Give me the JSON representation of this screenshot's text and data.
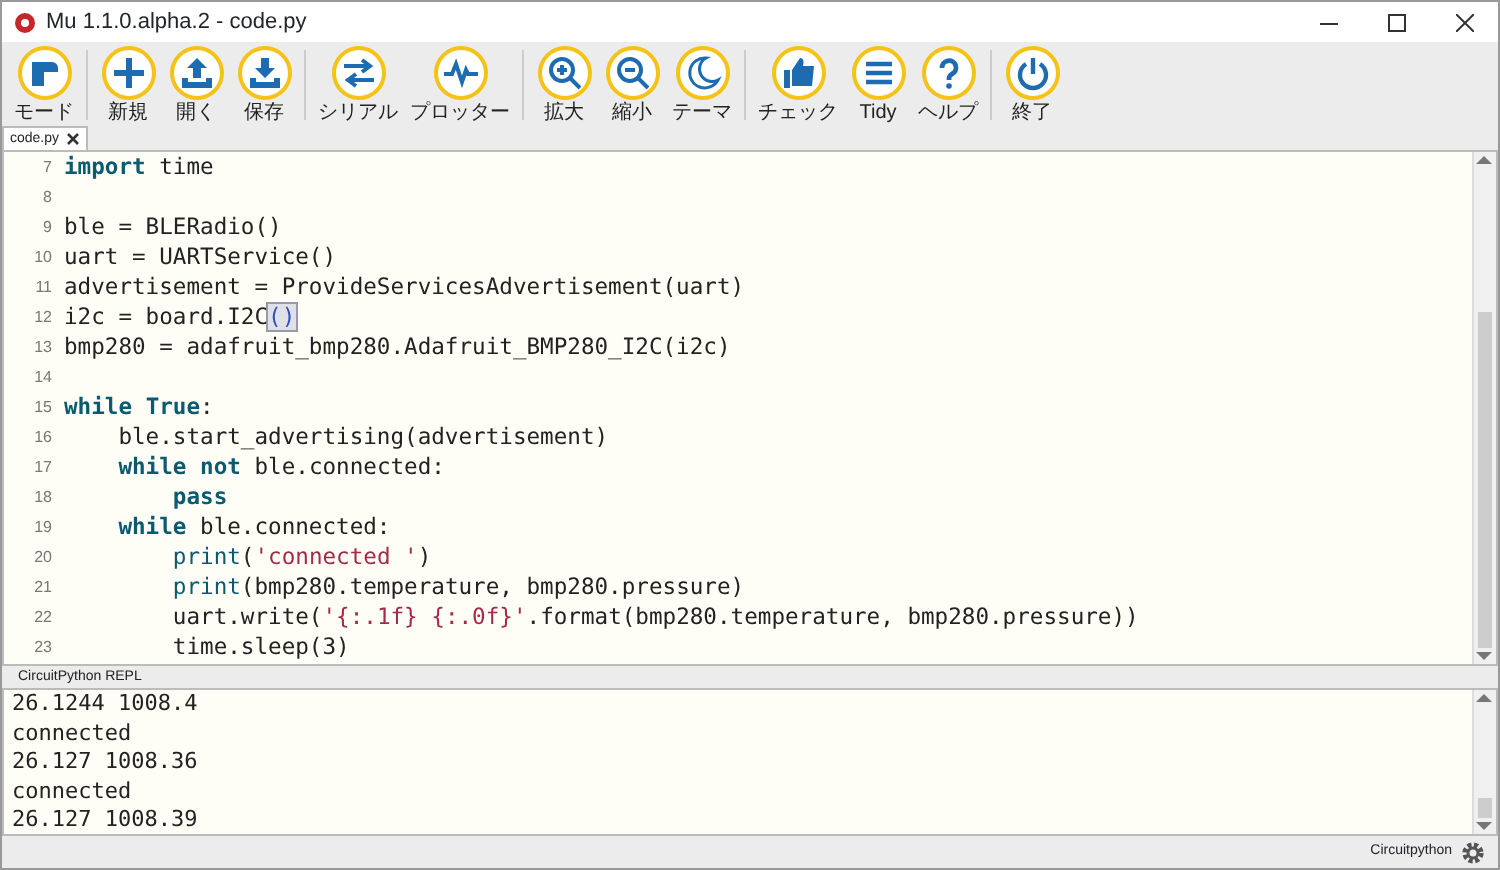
{
  "window": {
    "title": "Mu 1.1.0.alpha.2 - code.py"
  },
  "toolbar_groups": [
    [
      {
        "label": "モード"
      }
    ],
    [
      {
        "label": "新規"
      },
      {
        "label": "開く"
      },
      {
        "label": "保存"
      }
    ],
    [
      {
        "label": "シリアル"
      },
      {
        "label": "プロッター"
      }
    ],
    [
      {
        "label": "拡大"
      },
      {
        "label": "縮小"
      },
      {
        "label": "テーマ"
      }
    ],
    [
      {
        "label": "チェック"
      },
      {
        "label": "Tidy"
      },
      {
        "label": "ヘルプ"
      }
    ],
    [
      {
        "label": "終了"
      }
    ]
  ],
  "tabs": [
    {
      "label": "code.py",
      "selected": true
    }
  ],
  "editor": {
    "lines": [
      {
        "number": "7",
        "segments": [
          {
            "text": "import",
            "kind": "keyword"
          },
          {
            "text": " time",
            "kind": "plain"
          }
        ]
      },
      {
        "number": "8"
      },
      {
        "number": "9",
        "segments": [
          {
            "text": "ble = BLERadio()",
            "kind": "plain"
          }
        ]
      },
      {
        "number": "10",
        "segments": [
          {
            "text": "uart = UARTService()",
            "kind": "plain"
          }
        ]
      },
      {
        "number": "11",
        "segments": [
          {
            "text": "advertisement = ProvideServicesAdvertisement(uart)",
            "kind": "plain"
          }
        ]
      },
      {
        "number": "12",
        "segments": [
          {
            "text": "i2c = board.I2C",
            "kind": "plain"
          },
          {
            "text": "()",
            "kind": "match"
          }
        ]
      },
      {
        "number": "13",
        "segments": [
          {
            "text": "bmp280 = adafruit_bmp280.Adafruit_BMP280_I2C(i2c)",
            "kind": "plain"
          }
        ]
      },
      {
        "number": "14"
      },
      {
        "number": "15",
        "segments": [
          {
            "text": "while",
            "kind": "keyword"
          },
          {
            "text": " True",
            "kind": "keyword"
          },
          {
            "text": ":",
            "kind": "plain"
          }
        ]
      },
      {
        "number": "16",
        "segments": [
          {
            "text": "    ble.start_advertising(advertisement)",
            "kind": "plain"
          }
        ]
      },
      {
        "number": "17",
        "segments": [
          {
            "text": "    while",
            "kind": "keyword"
          },
          {
            "text": " not",
            "kind": "keyword"
          },
          {
            "text": " ble.connected:",
            "kind": "plain"
          }
        ]
      },
      {
        "number": "18",
        "segments": [
          {
            "text": "        pass",
            "kind": "keyword"
          }
        ]
      },
      {
        "number": "19",
        "segments": [
          {
            "text": "    while",
            "kind": "keyword"
          },
          {
            "text": " ble.connected:",
            "kind": "plain"
          }
        ]
      },
      {
        "number": "20",
        "segments": [
          {
            "text": "        print",
            "kind": "builtin"
          },
          {
            "text": "(",
            "kind": "plain"
          },
          {
            "text": "'connected '",
            "kind": "string"
          },
          {
            "text": ")",
            "kind": "plain"
          }
        ]
      },
      {
        "number": "21",
        "segments": [
          {
            "text": "        print",
            "kind": "builtin"
          },
          {
            "text": "(bmp280.temperature, bmp280.pressure)",
            "kind": "plain"
          }
        ]
      },
      {
        "number": "22",
        "segments": [
          {
            "text": "        uart.write(",
            "kind": "plain"
          },
          {
            "text": "'{:.1f} {:.0f}'",
            "kind": "string"
          },
          {
            "text": ".format(bmp280.temperature, bmp280.pressure))",
            "kind": "plain"
          }
        ]
      },
      {
        "number": "23",
        "segments": [
          {
            "text": "        time.sleep(3)",
            "kind": "plain"
          }
        ]
      }
    ]
  },
  "repl": {
    "title": "CircuitPython REPL",
    "lines": [
      "26.1244 1008.4",
      "connected",
      "26.127 1008.36",
      "connected",
      "26.127 1008.39"
    ]
  },
  "status_bar": {
    "mode": "Circuitpython"
  }
}
